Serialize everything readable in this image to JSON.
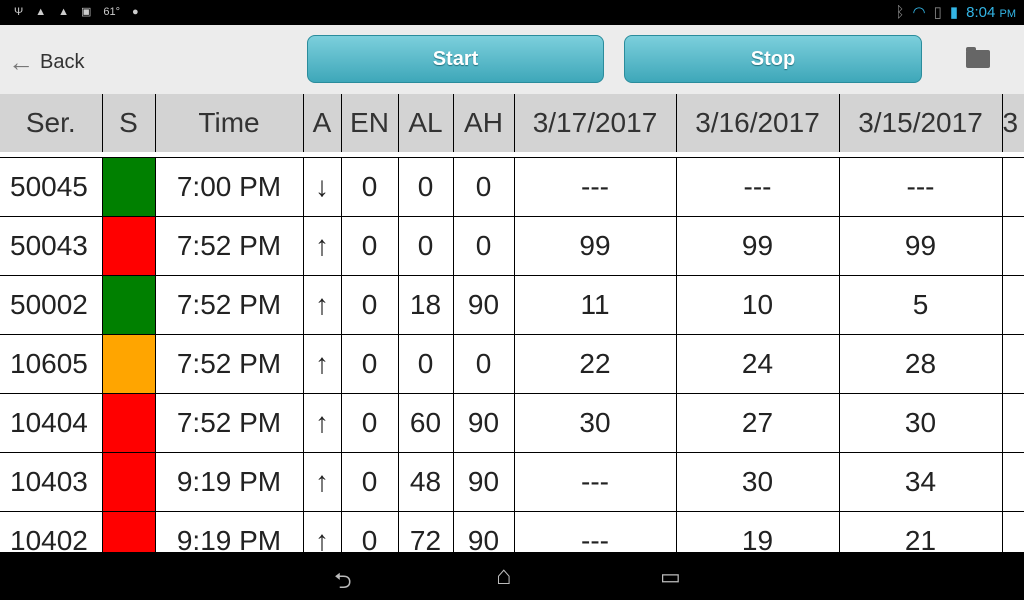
{
  "statusbar": {
    "icons": [
      "usb-icon",
      "warning-icon",
      "warning-icon",
      "image-icon",
      "android-icon"
    ],
    "temp": "61°",
    "time": "8:04",
    "ampm": "PM"
  },
  "toolbar": {
    "back_label": "Back",
    "start_label": "Start",
    "stop_label": "Stop"
  },
  "table": {
    "headers": [
      "Ser.",
      "S",
      "Time",
      "A",
      "EN",
      "AL",
      "AH",
      "3/17/2017",
      "3/16/2017",
      "3/15/2017",
      "3"
    ],
    "rows": [
      {
        "ser": "50045",
        "status": "#008000",
        "time": "7:00 PM",
        "a": "↓",
        "en": "0",
        "al": "0",
        "ah": "0",
        "d1": "---",
        "d2": "---",
        "d3": "---"
      },
      {
        "ser": "50043",
        "status": "#ff0000",
        "time": "7:52 PM",
        "a": "↑",
        "en": "0",
        "al": "0",
        "ah": "0",
        "d1": "99",
        "d2": "99",
        "d3": "99"
      },
      {
        "ser": "50002",
        "status": "#008000",
        "time": "7:52 PM",
        "a": "↑",
        "en": "0",
        "al": "18",
        "ah": "90",
        "d1": "11",
        "d2": "10",
        "d3": "5"
      },
      {
        "ser": "10605",
        "status": "#ffa500",
        "time": "7:52 PM",
        "a": "↑",
        "en": "0",
        "al": "0",
        "ah": "0",
        "d1": "22",
        "d2": "24",
        "d3": "28"
      },
      {
        "ser": "10404",
        "status": "#ff0000",
        "time": "7:52 PM",
        "a": "↑",
        "en": "0",
        "al": "60",
        "ah": "90",
        "d1": "30",
        "d2": "27",
        "d3": "30"
      },
      {
        "ser": "10403",
        "status": "#ff0000",
        "time": "9:19 PM",
        "a": "↑",
        "en": "0",
        "al": "48",
        "ah": "90",
        "d1": "---",
        "d2": "30",
        "d3": "34"
      },
      {
        "ser": "10402",
        "status": "#ff0000",
        "time": "9:19 PM",
        "a": "↑",
        "en": "0",
        "al": "72",
        "ah": "90",
        "d1": "---",
        "d2": "19",
        "d3": "21"
      }
    ]
  },
  "navbar": {
    "back": "⮌",
    "home": "⌂",
    "recents": "▭"
  }
}
